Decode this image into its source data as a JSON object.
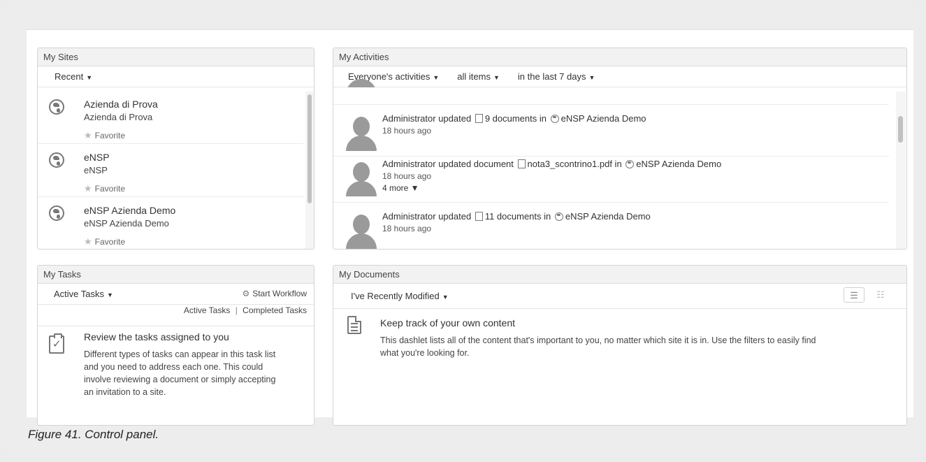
{
  "my_sites": {
    "title": "My Sites",
    "filter": "Recent",
    "sites": [
      {
        "name": "Azienda di Prova",
        "description": "Azienda di Prova",
        "favorite": "Favorite"
      },
      {
        "name": "eNSP",
        "description": "eNSP",
        "favorite": "Favorite"
      },
      {
        "name": "eNSP Azienda Demo",
        "description": "eNSP Azienda Demo",
        "favorite": "Favorite"
      }
    ]
  },
  "my_activities": {
    "title": "My Activities",
    "filters": [
      "Everyone's activities",
      "all items",
      "in the last 7 days"
    ],
    "items": [
      {
        "prefix": "Administrator updated",
        "target": "9 documents in",
        "site": "eNSP Azienda Demo",
        "time": "18 hours ago"
      },
      {
        "prefix": "Administrator updated document",
        "target": "nota3_scontrino1.pdf in",
        "site": "eNSP Azienda Demo",
        "time": "18 hours ago",
        "more": "4 more ▼"
      },
      {
        "prefix": "Administrator updated",
        "target": "11 documents in",
        "site": "eNSP Azienda Demo",
        "time": "18 hours ago"
      }
    ]
  },
  "my_tasks": {
    "title": "My Tasks",
    "filter": "Active Tasks",
    "start_workflow": "Start Workflow",
    "link_active": "Active Tasks",
    "link_separator": "|",
    "link_completed": "Completed Tasks",
    "empty_title": "Review the tasks assigned to you",
    "empty_text_lines": [
      "Different types of tasks can appear in this task list",
      "and you need to address each one. This could",
      "involve reviewing a document or simply accepting",
      "an invitation to a site."
    ]
  },
  "my_documents": {
    "title": "My Documents",
    "filter": "I've Recently Modified",
    "empty_title": "Keep track of your own content",
    "empty_text_lines": [
      "This dashlet lists all of the content that's important to you, no matter which site it is in. Use the filters to easily find",
      "what you're looking for."
    ]
  },
  "caption": "Figure 41. Control panel."
}
